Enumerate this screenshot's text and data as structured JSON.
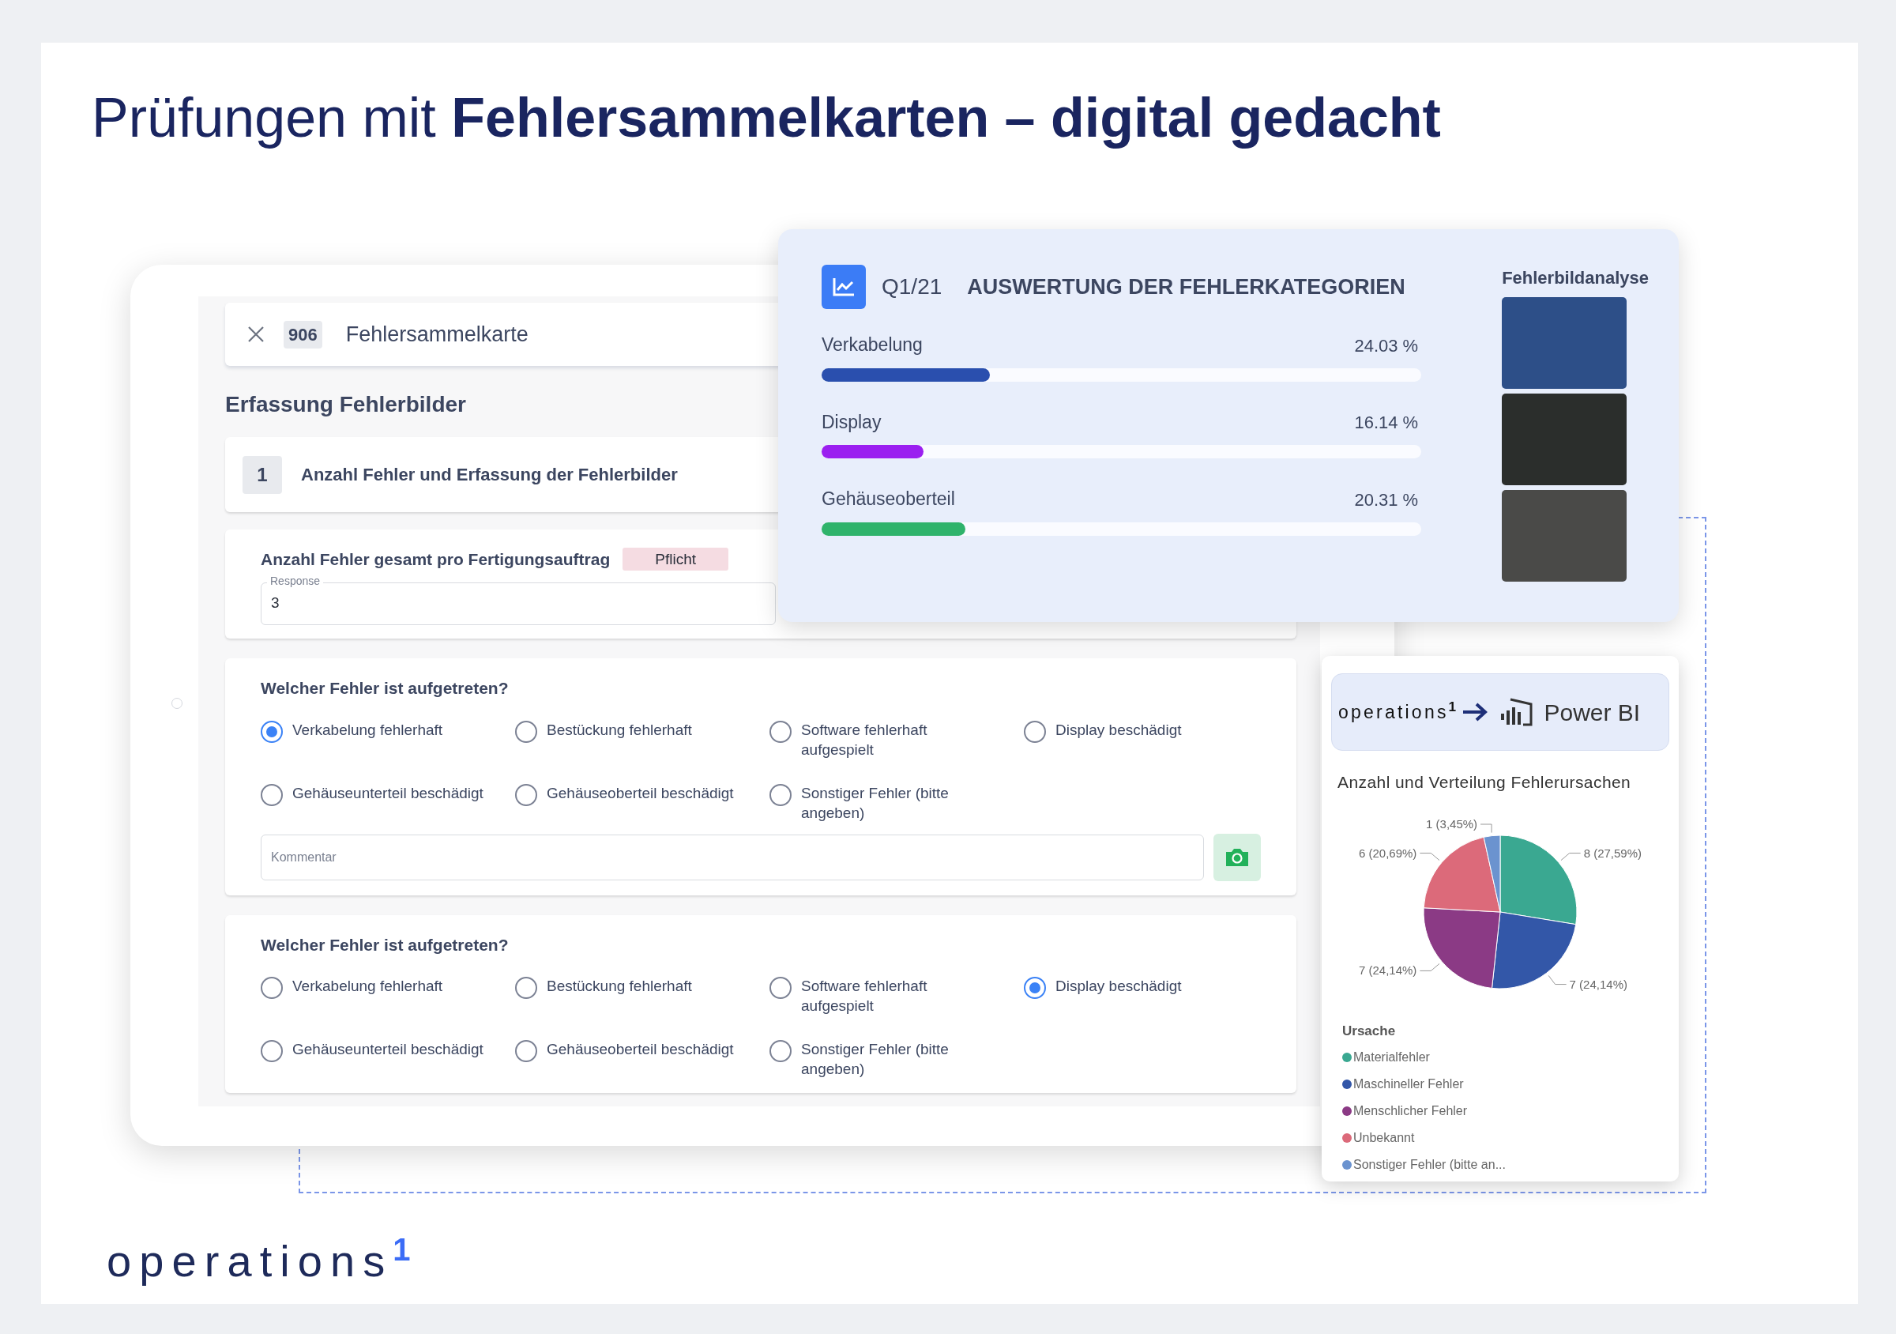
{
  "title": "Prüfungen mit **Fehlersammelkarten – digital gedacht**",
  "form": {
    "header": {
      "number": "906",
      "title": "Fehlersammelkarte"
    },
    "section_title": "Erfassung Fehlerbilder",
    "step": {
      "number": "1",
      "title": "Anzahl Fehler und Erfassung der Fehlerbilder"
    },
    "count_question": {
      "label": "Anzahl Fehler gesamt pro Fertigungsauftrag",
      "badge": "Pflicht",
      "field_label": "Response",
      "value": "3"
    },
    "questions": [
      {
        "question": "Welcher Fehler ist aufgetreten?",
        "comment_placeholder": "Kommentar",
        "options": [
          {
            "label": "Verkabelung fehlerhaft",
            "selected": true
          },
          {
            "label": "Bestückung fehlerhaft",
            "selected": false
          },
          {
            "label": "Software fehlerhaft aufgespielt",
            "selected": false
          },
          {
            "label": "Display beschädigt",
            "selected": false
          },
          {
            "label": "Gehäuseunterteil beschädigt",
            "selected": false
          },
          {
            "label": "Gehäuseoberteil beschädigt",
            "selected": false
          },
          {
            "label": "Sonstiger Fehler (bitte angeben)",
            "selected": false
          }
        ]
      },
      {
        "question": "Welcher Fehler ist aufgetreten?",
        "options": [
          {
            "label": "Verkabelung fehlerhaft",
            "selected": false
          },
          {
            "label": "Bestückung fehlerhaft",
            "selected": false
          },
          {
            "label": "Software fehlerhaft aufgespielt",
            "selected": false
          },
          {
            "label": "Display beschädigt",
            "selected": true
          },
          {
            "label": "Gehäuseunterteil beschädigt",
            "selected": false
          },
          {
            "label": "Gehäuseoberteil beschädigt",
            "selected": false
          },
          {
            "label": "Sonstiger Fehler (bitte angeben)",
            "selected": false
          }
        ]
      }
    ]
  },
  "evaluation": {
    "period": "Q1/21",
    "title": "AUSWERTUNG DER FEHLERKATEGORIEN",
    "gallery_title": "Fehlerbildanalyse",
    "categories": [
      {
        "name": "Verkabelung",
        "value": "24.03 %",
        "level": 0.28,
        "color": "#2a4fae"
      },
      {
        "name": "Display",
        "value": "16.14 %",
        "level": 0.17,
        "color": "#9b1ff0"
      },
      {
        "name": "Gehäuseoberteil",
        "value": "20.31 %",
        "level": 0.24,
        "color": "#2fb36b"
      }
    ]
  },
  "powerbi": {
    "brand": "operations$^{1}$",
    "product": "Power BI",
    "chart_data": {
      "type": "pie",
      "title": "Anzahl und Verteilung Fehlerursachen",
      "categories": [
        "Materialfehler",
        "Maschineller Fehler",
        "Menschlicher Fehler",
        "Unbekannt",
        "Sonstiger Fehler (bitte an..."
      ],
      "values": [
        8,
        7,
        7,
        6,
        1
      ],
      "value_labels": [
        "8 (27,59%)",
        "7 (24,14%)",
        "7 (24,14%)",
        "6 (20,69%)",
        "1 (3,45%)"
      ]
    },
    "legend": {
      "title": "Ursache",
      "items": [
        {
          "color": "#3aa891"
        },
        {
          "color": "#3357a8"
        },
        {
          "color": "#8b3a85"
        },
        {
          "color": "#dc6a7a"
        },
        {
          "color": "#6b93cf"
        }
      ]
    }
  },
  "logo": "operations$^{1}$"
}
